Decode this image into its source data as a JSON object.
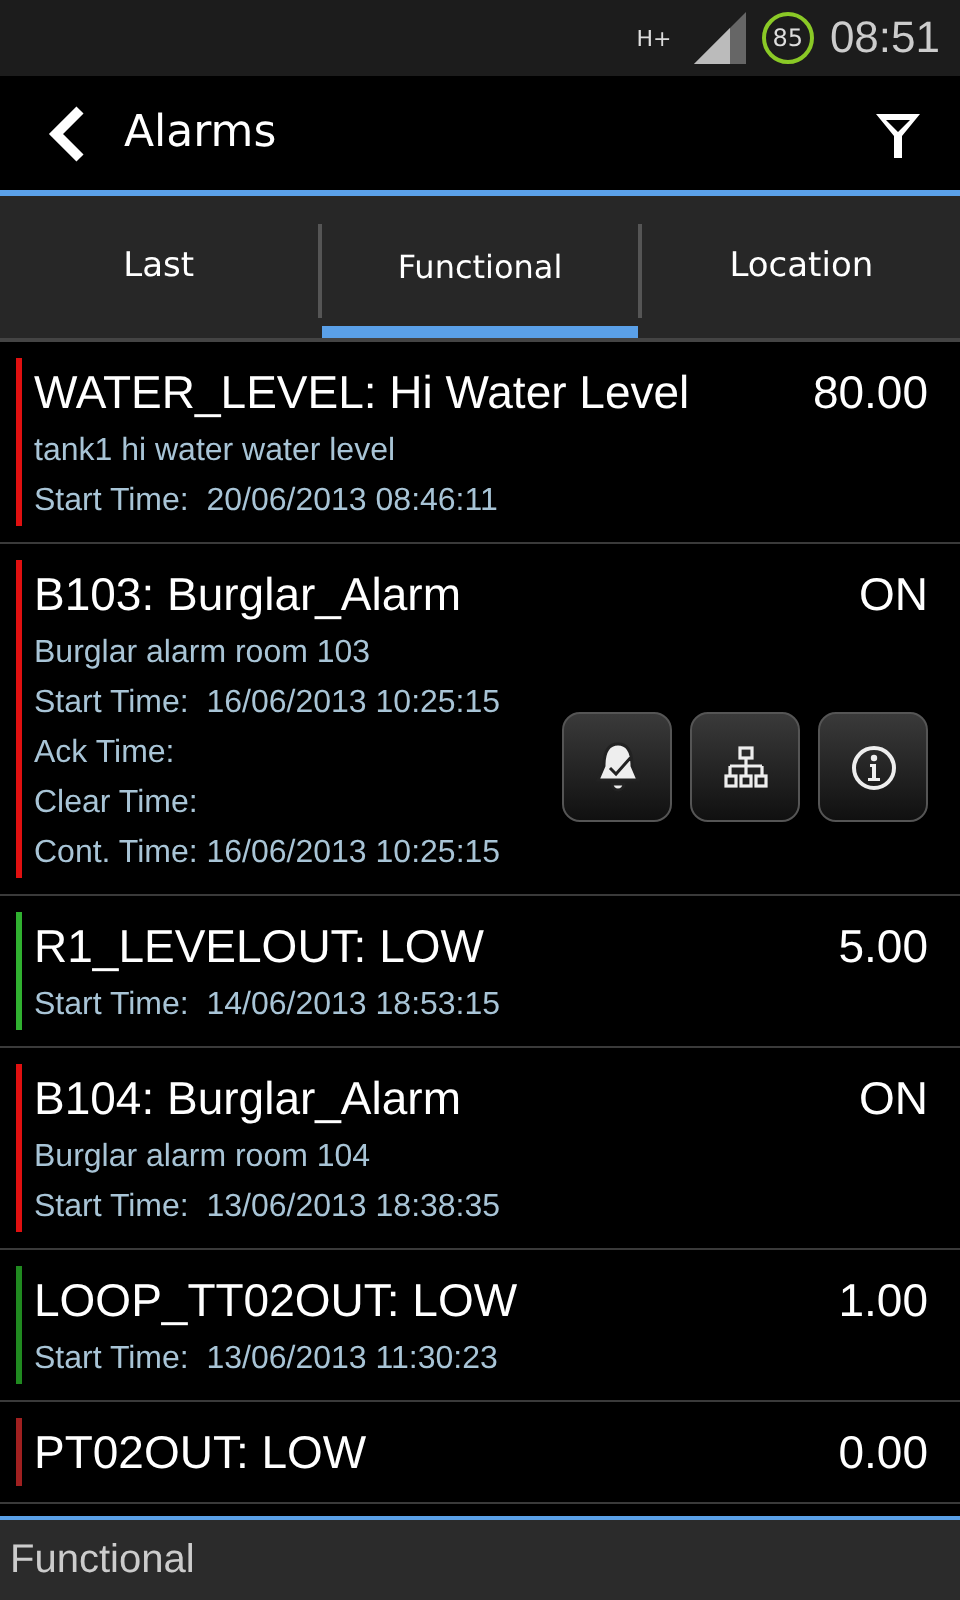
{
  "status_bar": {
    "network_type": "H+",
    "battery": "85",
    "time": "08:51"
  },
  "action_bar": {
    "title": "Alarms"
  },
  "tabs": [
    {
      "label": "Last",
      "selected": false
    },
    {
      "label": "Functional",
      "selected": true
    },
    {
      "label": "Location",
      "selected": false
    }
  ],
  "alarms": [
    {
      "title": "WATER_LEVEL: Hi Water Level",
      "value": "80.00",
      "color": "#e01010",
      "expanded": false,
      "lines": [
        "tank1 hi water water level",
        "Start Time:  20/06/2013 08:46:11"
      ]
    },
    {
      "title": "B103: Burglar_Alarm",
      "value": "ON",
      "color": "#e01010",
      "expanded": true,
      "lines": [
        "Burglar alarm room 103",
        "Start Time:  16/06/2013 10:25:15",
        "Ack Time:",
        "Clear Time:",
        "Cont. Time: 16/06/2013 10:25:15"
      ]
    },
    {
      "title": "R1_LEVELOUT: LOW",
      "value": "5.00",
      "color": "#30b030",
      "expanded": false,
      "lines": [
        "Start Time:  14/06/2013 18:53:15"
      ]
    },
    {
      "title": "B104: Burglar_Alarm",
      "value": "ON",
      "color": "#e01010",
      "expanded": false,
      "lines": [
        "Burglar alarm room 104",
        "Start Time:  13/06/2013 18:38:35"
      ]
    },
    {
      "title": "LOOP_TT02OUT: LOW",
      "value": "1.00",
      "color": "#208a20",
      "expanded": false,
      "lines": [
        "Start Time:  13/06/2013 11:30:23"
      ]
    },
    {
      "title": "PT02OUT: LOW",
      "value": "0.00",
      "color": "#a02020",
      "expanded": false
    }
  ],
  "footer": {
    "label": "Functional"
  }
}
